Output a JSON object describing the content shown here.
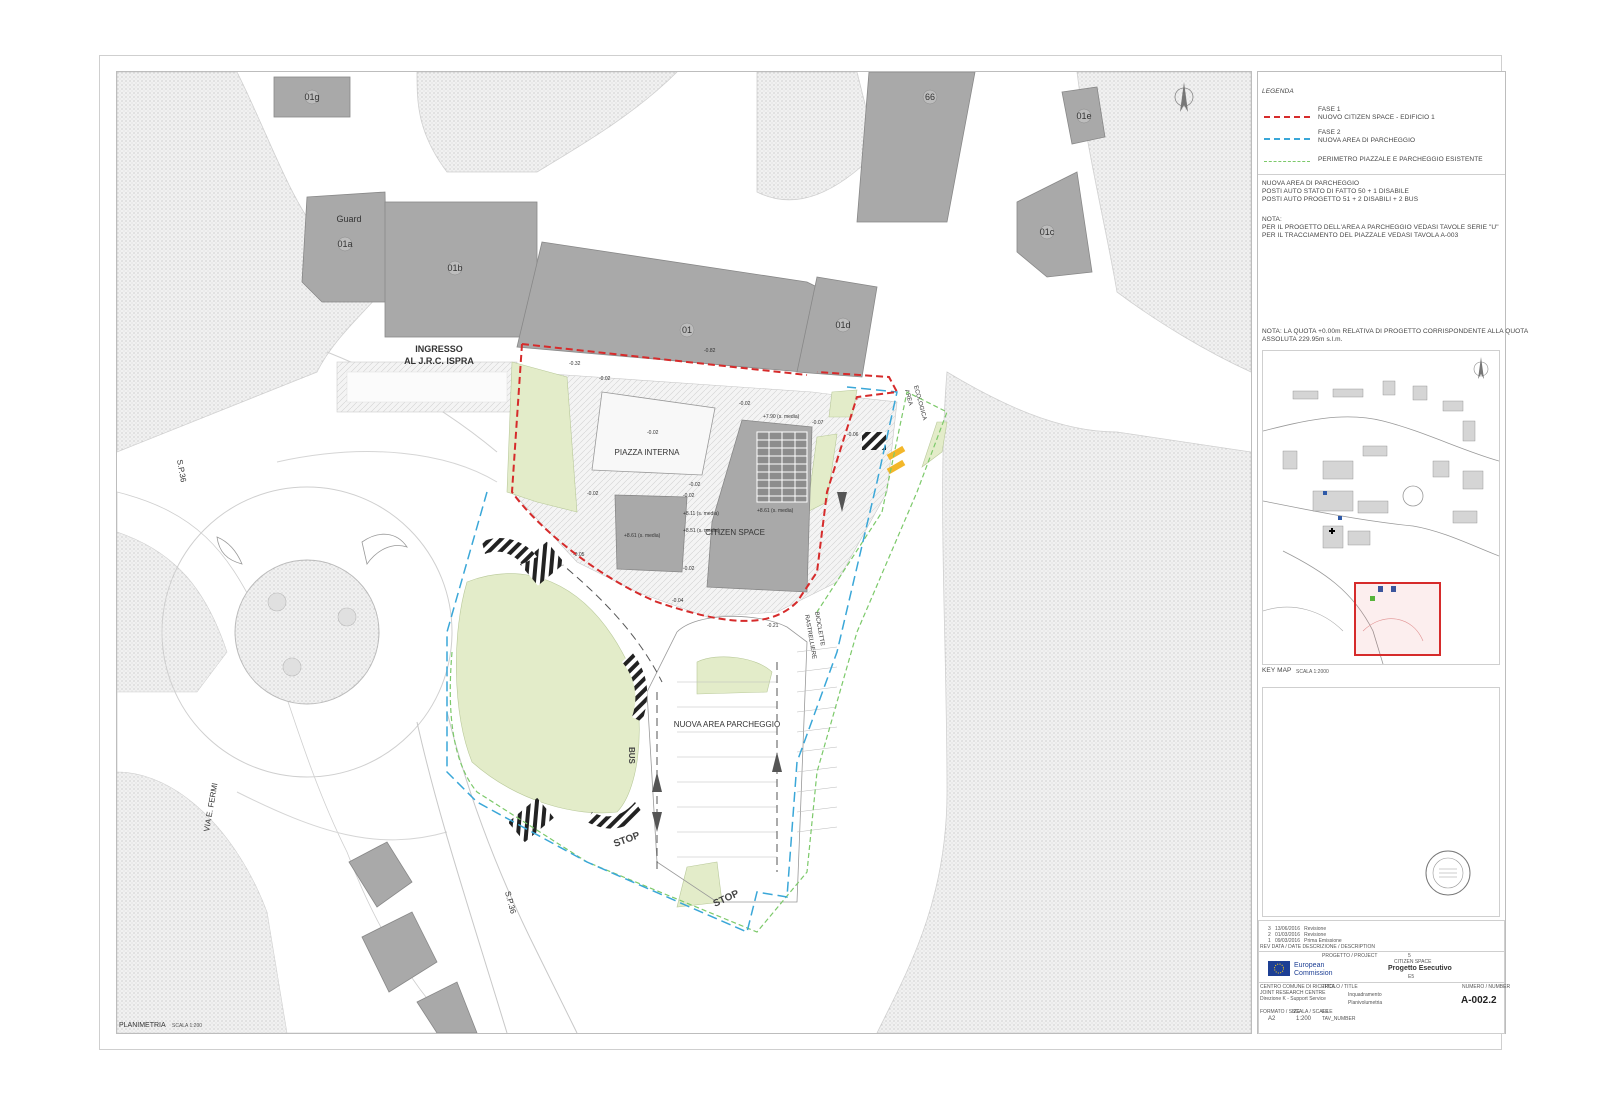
{
  "plan": {
    "buildings": {
      "b01g": "01g",
      "b66": "66",
      "b01e": "01e",
      "guard": "Guard",
      "b01a": "01a",
      "b01b": "01b",
      "b01": "01",
      "b01d": "01d",
      "b01c": "01c"
    },
    "entrance_line1": "INGRESSO",
    "entrance_line2": "AL J.R.C. ISPRA",
    "road_sp36_top": "S.P.36",
    "road_sp36_bottom": "S.P.36",
    "road_via_fermi": "VIA E. FERMI",
    "piazza_interna": "PIAZZA INTERNA",
    "citizen_space": "CITIZEN SPACE",
    "nuova_area_parcheggio": "NUOVA AREA PARCHEGGIO",
    "rastrelliere_line1": "RASTRELLIERE",
    "rastrelliere_line2": "BICICLETTE",
    "area_ecologica_line1": "AREA",
    "area_ecologica_line2": "ECOLOGICA",
    "stop": "STOP",
    "bus": "BUS",
    "elevations": {
      "e1": "-0.82",
      "e2": "-0.02",
      "e3": "-0.02",
      "e4": "-0.02",
      "e5": "-0.02",
      "e6": "-0.02",
      "e7": "-0.04",
      "e8": "-0.05",
      "e9": "-0.06",
      "e10": "-0.21",
      "e11": "+7.90 (s. media)",
      "e12": "+8.61 (s. media)",
      "e13": "+8.11 (s. media)",
      "e14": "+8.51 (s. media)",
      "e15": "+8.61 (s. media)",
      "e16": "-0.02",
      "e17": "-0.02",
      "e18": "-0.32",
      "e19": "-0.07"
    },
    "footer_title": "PLANIMETRIA",
    "footer_scale": "SCALA 1:200"
  },
  "legend": {
    "heading": "LEGENDA",
    "items": [
      {
        "line1": "FASE 1",
        "line2": "NUOVO CITIZEN SPACE - EDIFICIO 1",
        "color": "#d62b2b"
      },
      {
        "line1": "FASE 2",
        "line2": "NUOVA AREA DI PARCHEGGIO",
        "color": "#3aa7d8"
      },
      {
        "line1": "PERIMETRO PIAZZALE E PARCHEGGIO ESISTENTE",
        "line2": "",
        "color": "#7cc96a"
      }
    ]
  },
  "notes": {
    "parking_title": "NUOVA AREA DI PARCHEGGIO",
    "parking_line1": "POSTI AUTO STATO DI FATTO 50 + 1 DISABILE",
    "parking_line2": "POSTI AUTO PROGETTO 51 + 2 DISABILI + 2 BUS",
    "nota_title": "NOTA:",
    "nota_line1": "PER IL PROGETTO DELL'AREA A PARCHEGGIO VEDASI TAVOLE SERIE \"U\"",
    "nota_line2": "PER IL TRACCIAMENTO DEL PIAZZALE VEDASI TAVOLA A-003",
    "quota_line1": "NOTA: LA QUOTA +0.00m RELATIVA DI PROGETTO CORRISPONDENTE ALLA QUOTA",
    "quota_line2": "ASSOLUTA 229.95m s.l.m."
  },
  "keymap": {
    "label": "KEY MAP",
    "scale": "SCALA 1:2000"
  },
  "titleblock": {
    "revisions": [
      {
        "no": "3",
        "date": "13/06/2016",
        "desc": "Revisione"
      },
      {
        "no": "2",
        "date": "01/03/2016",
        "desc": "Revisione"
      },
      {
        "no": "1",
        "date": "09/03/2016",
        "desc": "Prima Emissione"
      }
    ],
    "rev_header": "REV  DATA / DATE      DESCRIZIONE / DESCRIPTION",
    "project_label": "PROGETTO / PROJECT",
    "project_no": "5",
    "project_name": "CITIZEN SPACE",
    "phase": "Progetto Esecutivo",
    "phase_code": "E5",
    "ec_line1": "European",
    "ec_line2": "Commission",
    "jrc_line1": "CENTRO COMUNE DI RICERCA",
    "jrc_line2": "JOINT RESEARCH CENTRE",
    "jrc_line3": "Direzione K - Support Service",
    "titolo_label": "TITOLO / TITLE",
    "titolo_line1": "Inquadramento",
    "titolo_line2": "Planivolumetria",
    "number_label": "NUMERO / NUMBER",
    "drawing_no": "A-002.2",
    "format_label": "FORMATO / SIZE",
    "format": "A2",
    "scale_label": "SCALA / SCALE",
    "scale": "1:200",
    "file_label": "FILE",
    "file": "TAV_NUMBER"
  },
  "colors": {
    "building": "#a9a9a9",
    "green": "#e3ecc9",
    "phase1": "#d62b2b",
    "phase2": "#3aa7d8",
    "existing": "#7cc96a",
    "keymap_frame": "#d62b2b"
  }
}
